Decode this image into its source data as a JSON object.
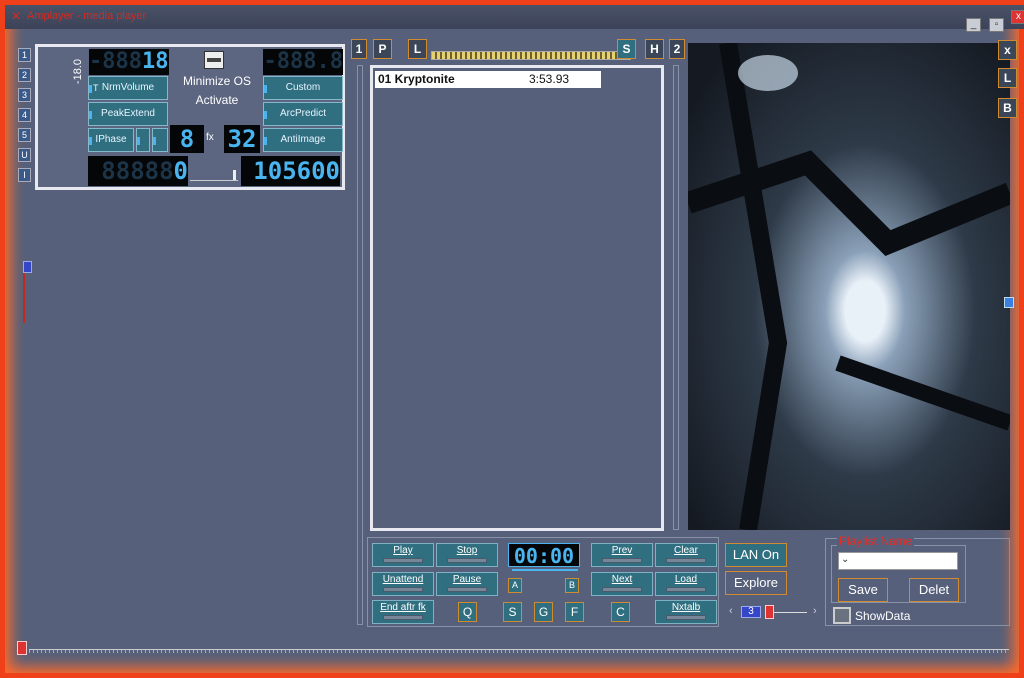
{
  "title": "Amplayer - media player",
  "window_controls": {
    "minimize": "_",
    "restore": "▫",
    "close": "x"
  },
  "side_buttons": [
    "1",
    "2",
    "3",
    "4",
    "5",
    "U",
    "I"
  ],
  "panel": {
    "lcd_left": "18.0",
    "lcd_left_dim": "-888",
    "vertical_label": "-18.0",
    "minimize_os": "Minimize OS",
    "activate": "Activate",
    "t_label": "T",
    "btn_nrm_volume": "NrmVolume",
    "btn_peak_extend": "PeakExtend",
    "btn_iphase": "IPhase",
    "btn_custom": "Custom",
    "btn_arc_predict": "ArcPredict",
    "btn_anti_image": "AntiImage",
    "lcd_right_dim": "-888.8",
    "lcd_mid_left": "8",
    "fx_label": "fx",
    "lcd_mid_right": "32",
    "lcd_counter_dim": "88888",
    "lcd_counter": "0",
    "lcd_rate": "105600"
  },
  "section_labels": {
    "one": "1",
    "two": "2"
  },
  "playlist_toolbar": {
    "p": "P",
    "l": "L",
    "s": "S",
    "h": "H"
  },
  "playlist": [
    {
      "title": "01 Kryptonite",
      "duration": "3:53.93"
    }
  ],
  "art_buttons": {
    "x": "x",
    "l": "L",
    "b": "B"
  },
  "controls": {
    "play": "Play",
    "stop": "Stop",
    "unattend": "Unattend",
    "pause": "Pause",
    "end_after": "End aftr fk",
    "prev": "Prev",
    "clear": "Clear",
    "next": "Next",
    "load": "Load",
    "nxtalb": "Nxtalb",
    "time": "00:00",
    "a": "A",
    "b": "B",
    "q": "Q",
    "s": "S",
    "g": "G",
    "f": "F",
    "c": "C"
  },
  "lan": {
    "lan_on": "LAN On",
    "explore": "Explore",
    "page": "3"
  },
  "playlist_name": {
    "label": "Playlist Name",
    "value": "",
    "save": "Save",
    "delete": "Delet",
    "show_data": "ShowData"
  }
}
